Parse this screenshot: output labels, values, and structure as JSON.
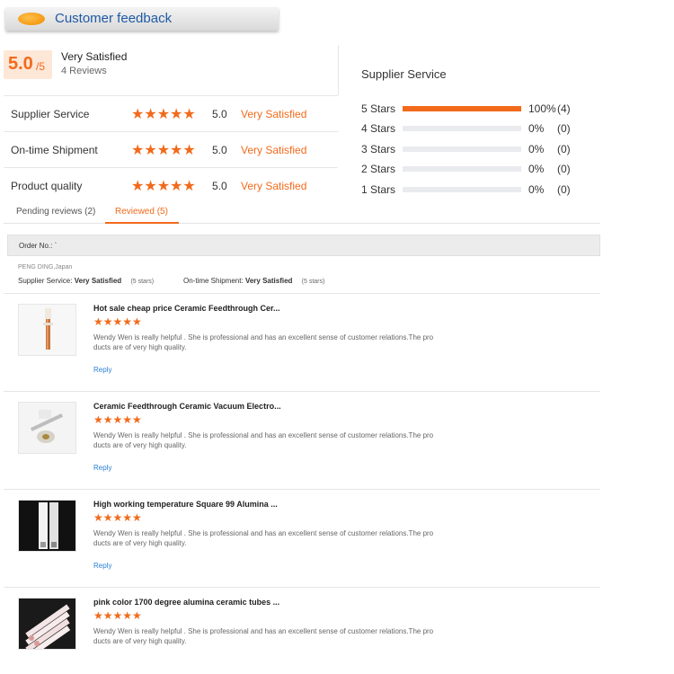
{
  "header": {
    "title": "Customer feedback",
    "icon": "orange-oval-icon"
  },
  "summary": {
    "score": "5.0",
    "score_max": "/5",
    "label": "Very Satisfied",
    "review_count": "4 Reviews"
  },
  "ratings": [
    {
      "label": "Supplier Service",
      "stars": "★★★★★",
      "score": "5.0",
      "text": "Very Satisfied"
    },
    {
      "label": "On-time Shipment",
      "stars": "★★★★★",
      "score": "5.0",
      "text": "Very Satisfied"
    },
    {
      "label": "Product quality",
      "stars": "★★★★★",
      "score": "5.0",
      "text": "Very Satisfied"
    }
  ],
  "distribution": {
    "title": "Supplier Service",
    "rows": [
      {
        "label": "5  Stars",
        "fraction": 1.0,
        "pct": "100%",
        "count": "(4)"
      },
      {
        "label": "4  Stars",
        "fraction": 0.0,
        "pct": "0%",
        "count": "(0)"
      },
      {
        "label": "3  Stars",
        "fraction": 0.0,
        "pct": "0%",
        "count": "(0)"
      },
      {
        "label": "2  Stars",
        "fraction": 0.0,
        "pct": "0%",
        "count": "(0)"
      },
      {
        "label": "1  Stars",
        "fraction": 0.0,
        "pct": "0%",
        "count": "(0)"
      }
    ]
  },
  "tabs": {
    "pending": "Pending reviews (2)",
    "reviewed": "Reviewed (5)"
  },
  "order": {
    "label": "Order No.: `"
  },
  "buyer": {
    "name": "PENG DING,Japan",
    "supplier_service_label": "Supplier Service:",
    "supplier_service_value": "Very Satisfied",
    "supplier_service_note": "(5 stars)",
    "shipment_label": "On-time Shipment:",
    "shipment_value": "Very Satisfied",
    "shipment_note": "(5 stars)"
  },
  "reviews": [
    {
      "title": "Hot sale cheap price Ceramic Feedthrough Cer...",
      "stars": "★★★★★",
      "text_line1": "Wendy Wen is really helpful . She is professional and has an excellent sense of customer relations.The pro",
      "text_line2": "ducts are of very high quality.",
      "reply": "Reply"
    },
    {
      "title": "Ceramic Feedthrough Ceramic Vacuum Electro...",
      "stars": "★★★★★",
      "text_line1": "Wendy Wen is really helpful . She is professional and has an excellent sense of customer relations.The pro",
      "text_line2": "ducts are of very high quality.",
      "reply": "Reply"
    },
    {
      "title": "High working temperature Square 99 Alumina ...",
      "stars": "★★★★★",
      "text_line1": "Wendy Wen is really helpful . She is professional and has an excellent sense of customer relations.The pro",
      "text_line2": "ducts are of very high quality.",
      "reply": "Reply"
    },
    {
      "title": "pink color 1700 degree alumina ceramic tubes ...",
      "stars": "★★★★★",
      "text_line1": "Wendy Wen is really helpful . She is professional and has an excellent sense of customer relations.The pro",
      "text_line2": "ducts are of very high quality.",
      "reply": ""
    }
  ],
  "colors": {
    "accent": "#f26a1b",
    "link": "#2a7fd4",
    "title": "#1f5aa6"
  }
}
